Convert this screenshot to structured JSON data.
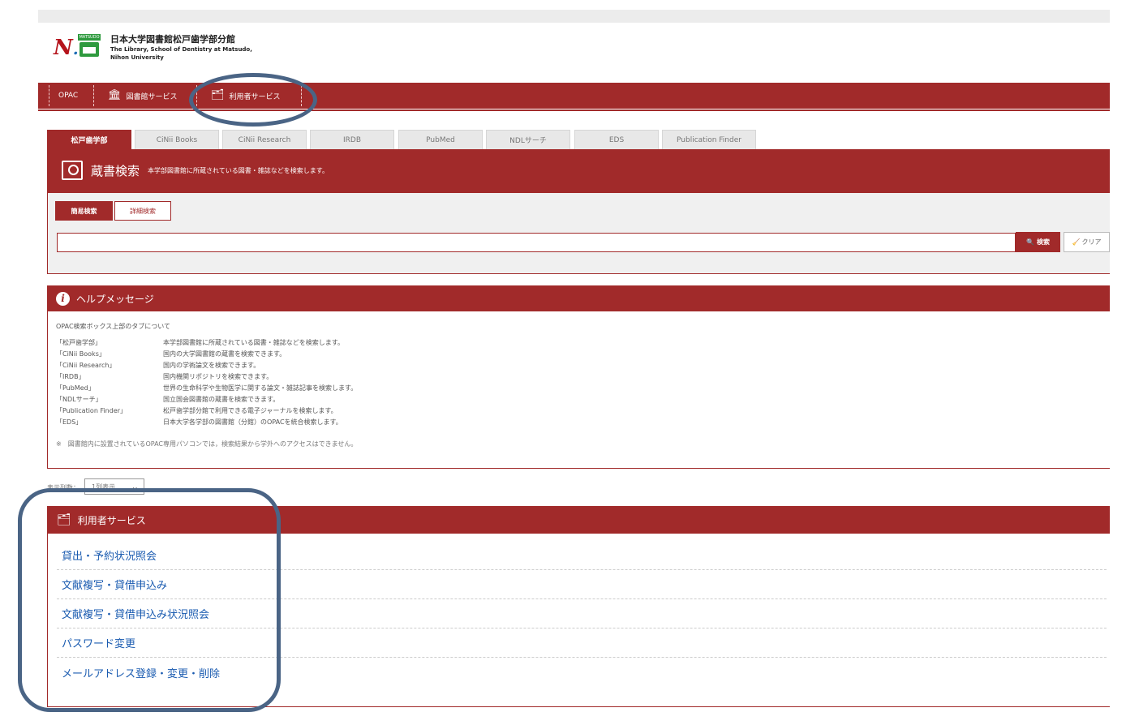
{
  "header": {
    "library_name_jp": "日本大学図書館松戸歯学部分館",
    "library_name_en_1": "The Library, School of Dentistry at Matsudo,",
    "library_name_en_2": "Nihon University",
    "logo_letter": "N",
    "logo_dot": ".",
    "logo_badge_text": "MATSUDO"
  },
  "nav": {
    "items": [
      {
        "label": "OPAC",
        "icon": ""
      },
      {
        "label": "図書館サービス",
        "icon": "building-icon"
      },
      {
        "label": "利用者サービス",
        "icon": "user-card-icon"
      }
    ]
  },
  "tabs": [
    {
      "label": "松戸歯学部",
      "active": true
    },
    {
      "label": "CiNii Books"
    },
    {
      "label": "CiNii Research"
    },
    {
      "label": "IRDB"
    },
    {
      "label": "PubMed"
    },
    {
      "label": "NDLサーチ"
    },
    {
      "label": "EDS"
    },
    {
      "label": "Publication Finder"
    }
  ],
  "search": {
    "title": "蔵書検索",
    "subtitle": "本学部図書館に所蔵されている図書・雑誌などを検索します。",
    "mode_simple": "簡易検索",
    "mode_advanced": "詳細検索",
    "input_value": "",
    "search_button": "検索",
    "search_icon": "🔍",
    "clear_button": "クリア",
    "clear_icon": "🧹"
  },
  "help": {
    "title": "ヘルプメッセージ",
    "intro": "OPAC検索ボックス上部のタブについて",
    "rows": [
      {
        "k": "「松戸歯学部」",
        "v": "本学部図書館に所蔵されている図書・雑誌などを検索します。"
      },
      {
        "k": "「CiNii Books」",
        "v": "国内の大学図書館の蔵書を検索できます。"
      },
      {
        "k": "「CiNii Research」",
        "v": "国内の学術論文を検索できます。"
      },
      {
        "k": "「IRDB」",
        "v": "国内機関リポジトリを検索できます。"
      },
      {
        "k": "「PubMed」",
        "v": "世界の生命科学や生物医学に関する論文・雑誌記事を検索します。"
      },
      {
        "k": "「NDLサーチ」",
        "v": "国立国会図書館の蔵書を検索できます。"
      },
      {
        "k": "「Publication Finder」",
        "v": "松戸歯学部分館で利用できる電子ジャーナルを検索します。"
      },
      {
        "k": "「EDS」",
        "v": "日本大学各学部の図書館（分館）のOPACを統合検索します。"
      }
    ],
    "note": "※　図書館内に設置されているOPAC専用パソコンでは，検索結果から学外へのアクセスはできません。"
  },
  "columns": {
    "label": "表示列数：",
    "selected": "1列表示",
    "chevron": "❯"
  },
  "user_services": {
    "title": "利用者サービス",
    "links": [
      "貸出・予約状況照会",
      "文献複写・貸借申込み",
      "文献複写・貸借申込み状況照会",
      "パスワード変更",
      "メールアドレス登録・変更・削除"
    ]
  },
  "colors": {
    "brand": "#a12a2a",
    "link": "#1a5bb0",
    "annotation": "#4a6485"
  }
}
